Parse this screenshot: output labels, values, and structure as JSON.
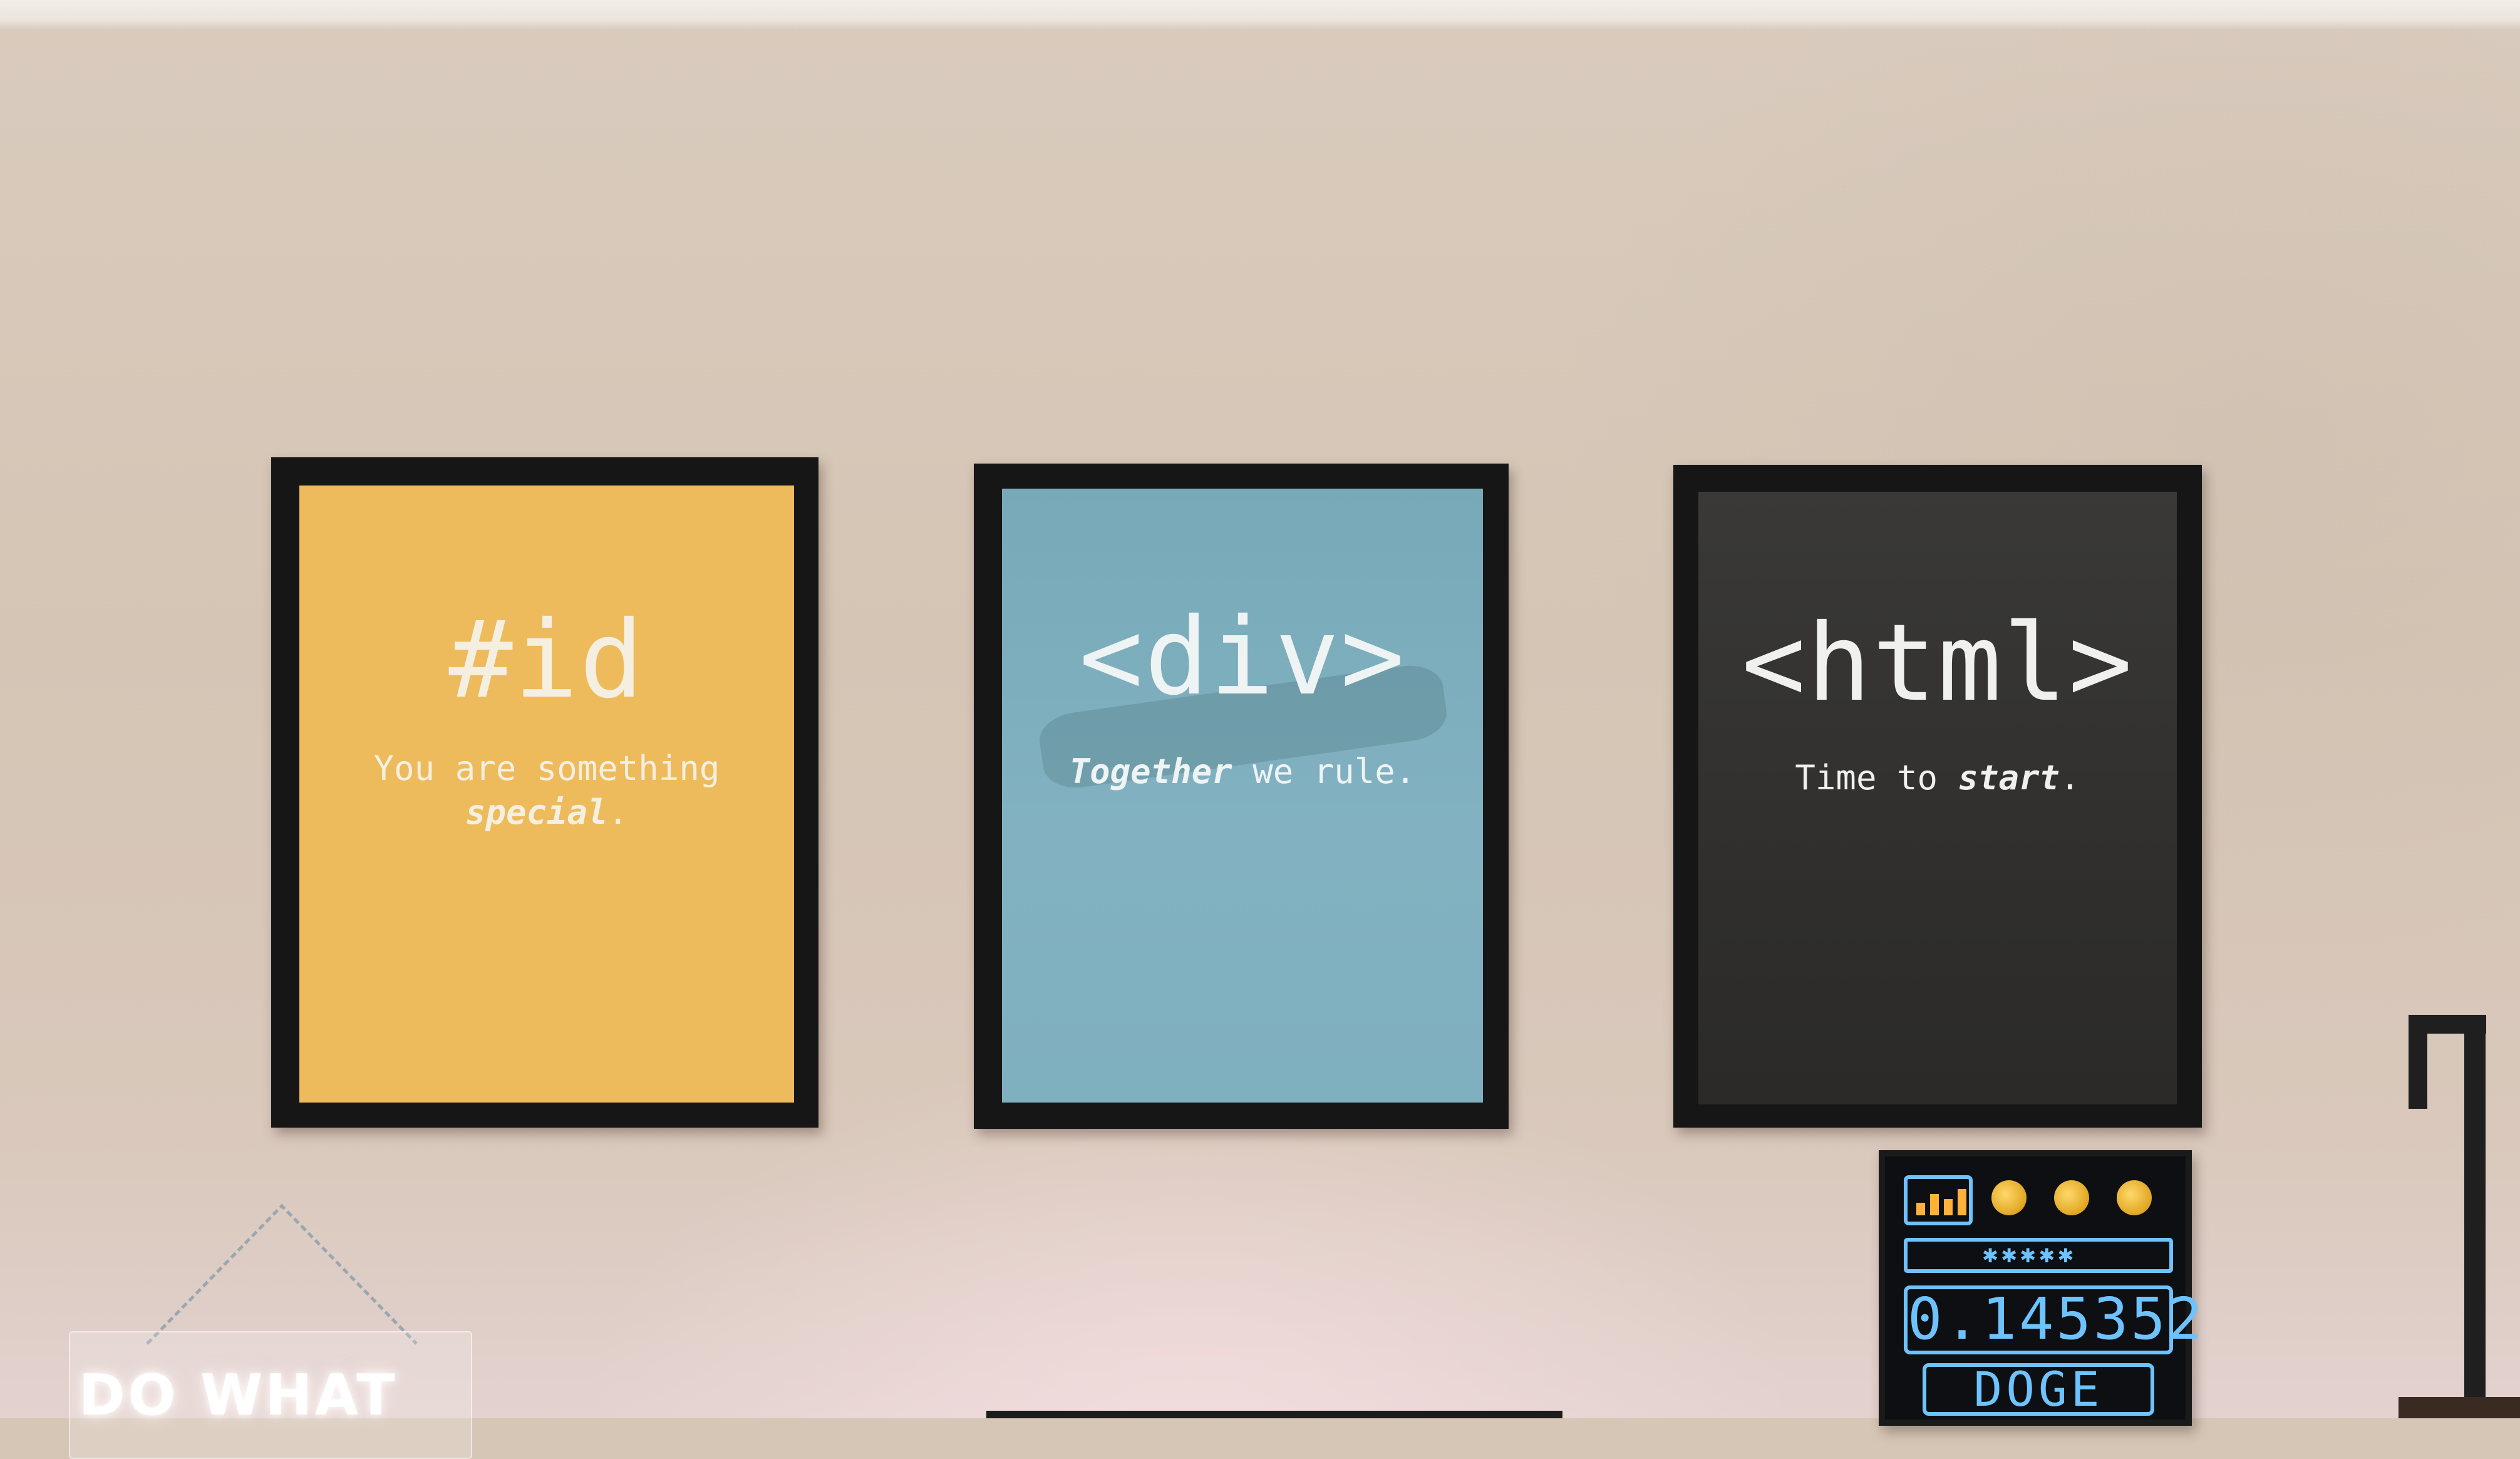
{
  "scene": {
    "wall_color": "#d6c6b6"
  },
  "posters": [
    {
      "name": "id-poster",
      "color": "#edbb5b",
      "headline": "#id",
      "line1": "You are something",
      "line2_bold": "special",
      "line2_rest": "."
    },
    {
      "name": "div-poster",
      "color": "#7eaebd",
      "headline": "<div>",
      "line1_bold": "Together",
      "line1_rest": " we rule."
    },
    {
      "name": "html-poster",
      "color": "#2f2e2c",
      "headline": "<html>",
      "line1_rest": "Time to ",
      "line1_bold": "start",
      "line1_end": "."
    }
  ],
  "pixel_display": {
    "price": "0.145352",
    "ticker": "DOGE",
    "accent": "#6ec3ff"
  },
  "neon_sign": {
    "text": "DO WHAT"
  }
}
